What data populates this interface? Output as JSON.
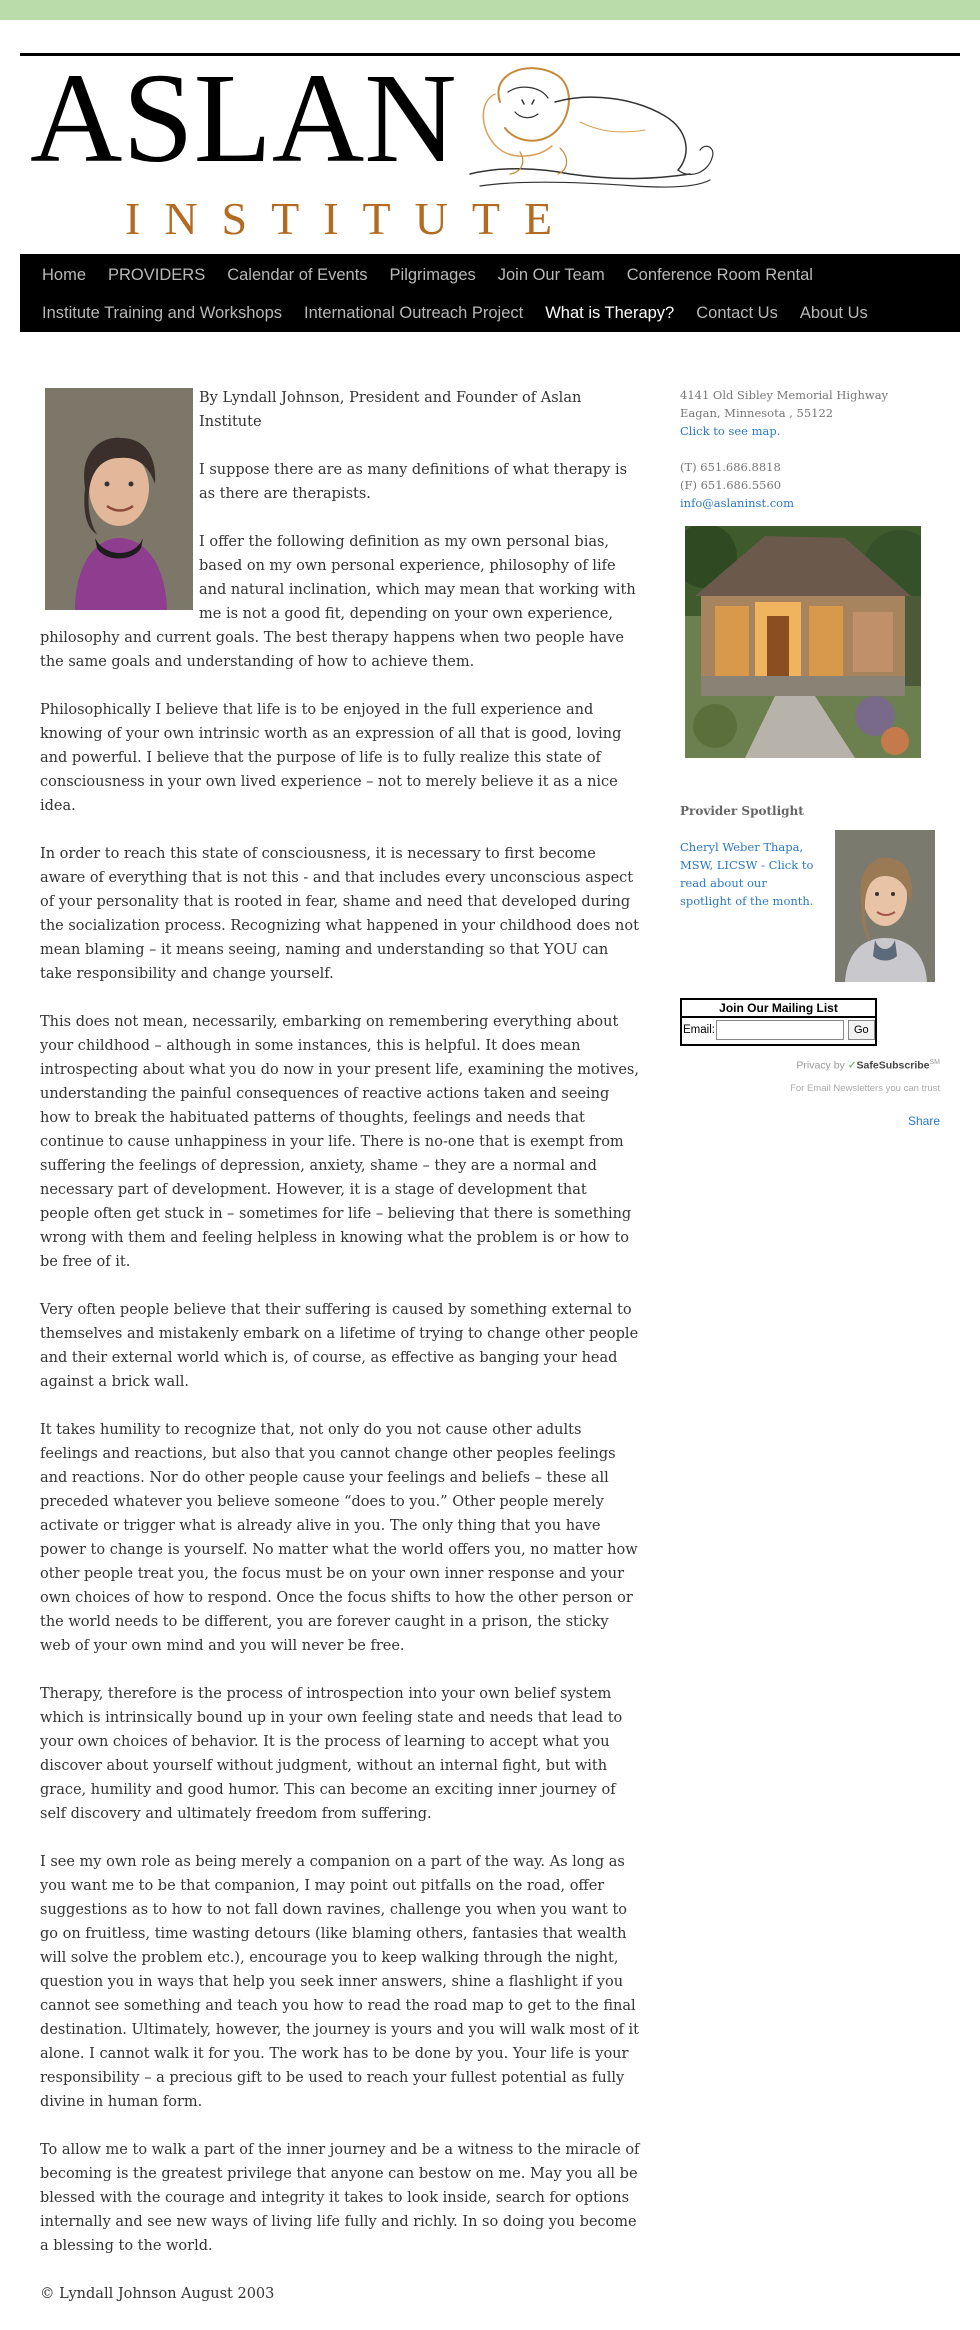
{
  "logo": {
    "word": "ASLAN",
    "sub": "INSTITUTE"
  },
  "nav": {
    "row1": [
      {
        "label": "Home"
      },
      {
        "label": "PROVIDERS"
      },
      {
        "label": "Calendar of Events"
      },
      {
        "label": "Pilgrimages"
      },
      {
        "label": "Join Our Team"
      },
      {
        "label": "Conference Room Rental"
      }
    ],
    "row2": [
      {
        "label": "Institute Training and Workshops"
      },
      {
        "label": "International Outreach Project"
      },
      {
        "label": "What is Therapy?"
      },
      {
        "label": "Contact Us"
      },
      {
        "label": "About Us"
      }
    ]
  },
  "article": {
    "paragraphs": [
      "By Lyndall Johnson, President and Founder of Aslan Institute",
      "I suppose there are as many definitions of what therapy is as there are therapists.",
      "I offer the following definition as my own personal bias, based on my own personal experience, philosophy of life and natural inclination, which may mean that working with me is not a good fit, depending on your own experience, philosophy and current goals.  The best therapy happens when two people have the same goals and understanding of how to achieve them.",
      "Philosophically I believe that life is to be enjoyed in the full experience and knowing of your own intrinsic worth as an expression of all that is good, loving and powerful.  I believe that the purpose of life is to fully realize this state of consciousness in your own lived experience – not to merely believe it as a nice idea.",
      "In order to reach this state of consciousness, it is necessary to first become aware of everything that is not this -  and that includes every unconscious aspect of your personality that is rooted in fear, shame and need that developed during the socialization process.  Recognizing what happened in your childhood does not mean blaming – it means seeing, naming and understanding so that YOU can take responsibility and change yourself.",
      "This does not mean, necessarily, embarking on remembering everything about your childhood – although in some instances, this is helpful.  It does mean introspecting about what you do now in your present life, examining the motives, understanding the painful consequences of reactive actions taken and seeing how to break the habituated patterns of thoughts, feelings and needs that continue to cause unhappiness in your life.  There is no-one that is exempt from suffering the feelings of depression, anxiety, shame – they are a normal and necessary part of development.   However, it is a stage of development that people often get stuck in – sometimes for life – believing that there is something wrong with them and feeling helpless in knowing what the problem is or how to be free of it.",
      "Very often people believe that their suffering is caused by something external to themselves and mistakenly embark on a lifetime of trying to change other people and their external world which is, of course, as effective as banging your head against a brick wall.",
      "It takes humility to recognize that, not only do you not cause other adults feelings and reactions, but also that you cannot change other peoples feelings and reactions.  Nor do other people cause your feelings and beliefs – these all preceded whatever you believe someone “does to you.” Other people merely activate or trigger what is already alive in you. The only thing that you have power to change is yourself.  No matter what the world offers you, no matter how other people treat you, the focus must be on your own inner response and your own choices of how to respond.  Once the focus shifts to how the other person or the world needs to be different, you are forever caught in a prison, the sticky web of your own mind and you will never be free.",
      "Therapy, therefore is the process of introspection into your own belief system which is intrinsically bound up in your own feeling state and needs that lead to your own choices of behavior.   It is the process of learning to accept what you discover about yourself without judgment, without an internal fight, but with grace, humility and good humor. This can become an exciting inner journey of self discovery and ultimately freedom from suffering.",
      "I see my own role as being merely a companion on a part of the way.  As long as you want me to be that companion, I may point out pitfalls on the road, offer suggestions as to how to not fall down ravines, challenge you when you want to go on fruitless, time wasting detours (like blaming others, fantasies that wealth will solve the problem etc.), encourage you to keep walking through the night, question you in ways that help you seek inner answers,  shine a flashlight if you cannot see something and teach you how to read the road map to get to the final destination.  Ultimately, however, the journey is yours and you will walk most of it alone.  I cannot walk it for you.  The work has to be done by you.  Your life is your responsibility – a precious gift to be used to reach your fullest potential as fully divine in human form.",
      "To allow me to walk a part of the inner journey and be a witness to the miracle of becoming is the greatest privilege that anyone can bestow on me.  May you all be blessed with the courage and integrity it takes to look inside, search for options internally and see new ways of living life fully and richly.  In so doing you become a blessing to the world.",
      "©  Lyndall Johnson August 2003"
    ]
  },
  "sidebar": {
    "address1": "4141 Old Sibley Memorial Highway",
    "address2": "Eagan, Minnesota , 55122",
    "map_link": "Click to see map.",
    "phone": "(T) 651.686.8818",
    "fax": "(F) 651.686.5560",
    "email": "info@aslaninst.com",
    "spotlight_title": "Provider Spotlight",
    "spotlight_text": "Cheryl Weber Thapa, MSW, LICSW - Click to read about our spotlight of the month.",
    "mailing_title": "Join Our Mailing List",
    "email_label": "Email:",
    "go_label": "Go",
    "privacy_by": "Privacy by",
    "safesubscribe": "SafeSubscribe",
    "safesubscribe_mark": "SM",
    "trust": "For Email Newsletters you can trust",
    "share": "Share"
  }
}
